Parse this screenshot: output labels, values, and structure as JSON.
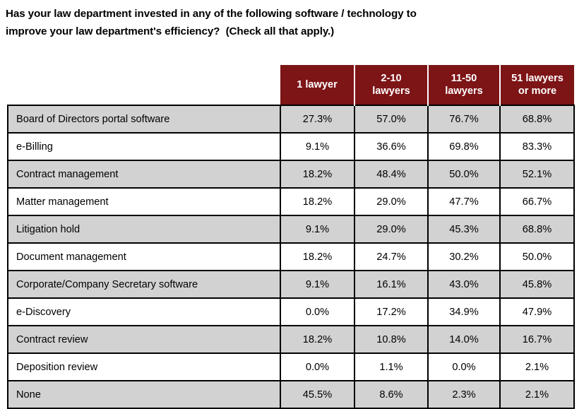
{
  "question": {
    "line1": "Has your law department invested in any of the following software / technology to",
    "line2": "improve your law department's efficiency?  (Check all that apply.)"
  },
  "colors": {
    "header_background": "#7d1416",
    "header_text": "#ffffff",
    "row_shaded": "#d2d2d2",
    "row_plain": "#ffffff",
    "border": "#000000"
  },
  "chart_data": {
    "type": "table",
    "title": "Has your law department invested in any of the following software / technology to improve your law department's efficiency?  (Check all that apply.)",
    "corner_label": "",
    "columns": [
      "1 lawyer",
      "2-10 lawyers",
      "11-50 lawyers",
      "51 lawyers or more"
    ],
    "column_lines": [
      [
        "1 lawyer"
      ],
      [
        "2-10",
        "lawyers"
      ],
      [
        "11-50",
        "lawyers"
      ],
      [
        "51 lawyers",
        "or more"
      ]
    ],
    "row_labels": [
      "Board of Directors portal software",
      "e-Billing",
      "Contract management",
      "Matter management",
      "Litigation hold",
      "Document management",
      "Corporate/Company Secretary software",
      "e-Discovery",
      "Contract review",
      "Deposition review",
      "None"
    ],
    "rows": [
      {
        "label": "Board of Directors portal software",
        "values": [
          "27.3%",
          "57.0%",
          "76.7%",
          "68.8%"
        ]
      },
      {
        "label": "e-Billing",
        "values": [
          "9.1%",
          "36.6%",
          "69.8%",
          "83.3%"
        ]
      },
      {
        "label": "Contract management",
        "values": [
          "18.2%",
          "48.4%",
          "50.0%",
          "52.1%"
        ]
      },
      {
        "label": "Matter management",
        "values": [
          "18.2%",
          "29.0%",
          "47.7%",
          "66.7%"
        ]
      },
      {
        "label": "Litigation hold",
        "values": [
          "9.1%",
          "29.0%",
          "45.3%",
          "68.8%"
        ]
      },
      {
        "label": "Document management",
        "values": [
          "18.2%",
          "24.7%",
          "30.2%",
          "50.0%"
        ]
      },
      {
        "label": "Corporate/Company Secretary software",
        "values": [
          "9.1%",
          "16.1%",
          "43.0%",
          "45.8%"
        ]
      },
      {
        "label": "e-Discovery",
        "values": [
          "0.0%",
          "17.2%",
          "34.9%",
          "47.9%"
        ]
      },
      {
        "label": "Contract review",
        "values": [
          "18.2%",
          "10.8%",
          "14.0%",
          "16.7%"
        ]
      },
      {
        "label": "Deposition review",
        "values": [
          "0.0%",
          "1.1%",
          "0.0%",
          "2.1%"
        ]
      },
      {
        "label": "None",
        "values": [
          "45.5%",
          "8.6%",
          "2.3%",
          "2.1%"
        ]
      }
    ],
    "series": [
      {
        "name": "1 lawyer",
        "values": [
          27.3,
          9.1,
          18.2,
          18.2,
          9.1,
          18.2,
          9.1,
          0.0,
          18.2,
          0.0,
          45.5
        ]
      },
      {
        "name": "2-10 lawyers",
        "values": [
          57.0,
          36.6,
          48.4,
          29.0,
          29.0,
          24.7,
          16.1,
          17.2,
          10.8,
          1.1,
          8.6
        ]
      },
      {
        "name": "11-50 lawyers",
        "values": [
          76.7,
          69.8,
          50.0,
          47.7,
          45.3,
          30.2,
          43.0,
          34.9,
          14.0,
          0.0,
          2.3
        ]
      },
      {
        "name": "51 lawyers or more",
        "values": [
          68.8,
          83.3,
          52.1,
          66.7,
          68.8,
          50.0,
          45.8,
          47.9,
          16.7,
          2.1,
          2.1
        ]
      }
    ],
    "xlabel": "",
    "ylabel": "",
    "unit": "percent",
    "grid": true,
    "legend": "none"
  }
}
